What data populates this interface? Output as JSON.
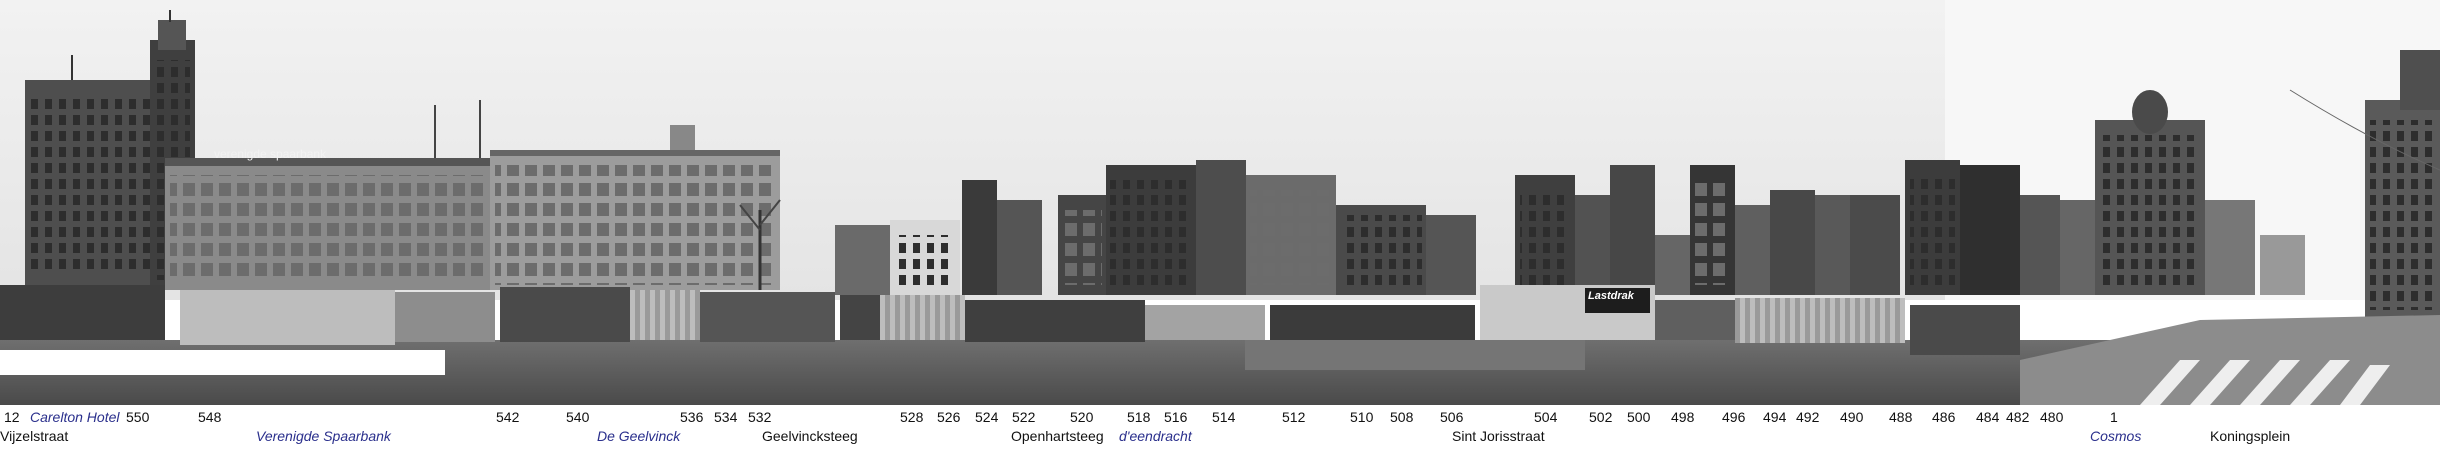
{
  "panorama": {
    "signs": {
      "spaarbank": "verenigde spaarbank",
      "lastdrak": "Lastdrak"
    },
    "house_numbers": [
      "12",
      "550",
      "548",
      "542",
      "540",
      "536",
      "534",
      "532",
      "528",
      "526",
      "524",
      "522",
      "520",
      "518",
      "516",
      "514",
      "512",
      "510",
      "508",
      "506",
      "504",
      "502",
      "500",
      "498",
      "496",
      "494",
      "492",
      "490",
      "488",
      "486",
      "484",
      "482",
      "480",
      "1"
    ],
    "streets": [
      "Vijzelstraat",
      "Geelvincksteeg",
      "Openhartsteeg",
      "Sint Jorisstraat",
      "Koningsplein"
    ],
    "building_names": [
      "Carelton Hotel",
      "Verenigde Spaarbank",
      "De Geelvinck",
      "d'eendracht",
      "Cosmos"
    ]
  }
}
